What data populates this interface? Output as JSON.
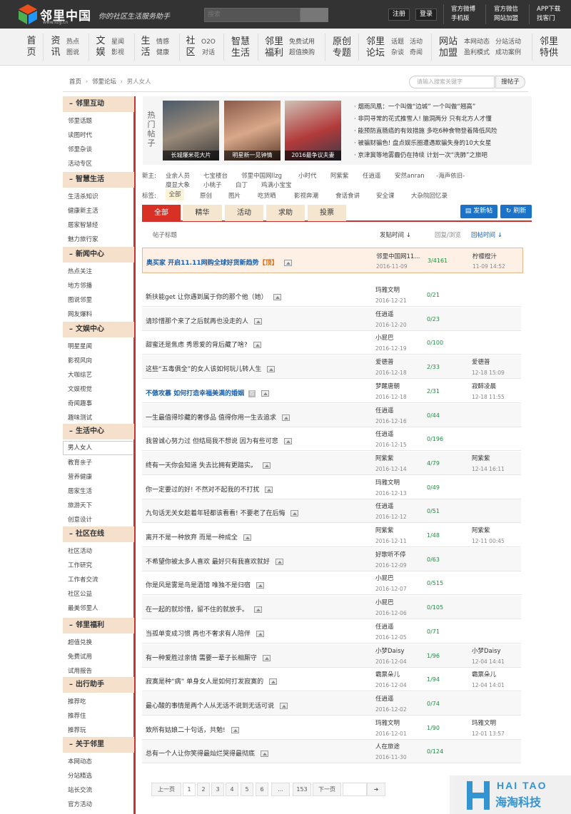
{
  "header": {
    "logo_text": "邻里中国",
    "logo_url": "www.llzg.cn",
    "slogan": "你的社区生活服务助手",
    "search_placeholder": "搜索",
    "register_label": "注册",
    "login_label": "登录",
    "links": [
      [
        "官方微博",
        "手机版"
      ],
      [
        "官方微信",
        "网站加盟"
      ],
      [
        "APP下载",
        "找客门"
      ]
    ]
  },
  "nav": {
    "items": [
      {
        "main": "首页",
        "subs": []
      },
      {
        "main": "资讯",
        "subs": [
          "热点",
          "图说"
        ]
      },
      {
        "main": "文娱",
        "subs": [
          "星闻",
          "影视"
        ]
      },
      {
        "main": "生活",
        "subs": [
          "情感",
          "健康"
        ]
      },
      {
        "main": "社区",
        "subs": [
          "O2O",
          "对话"
        ]
      },
      {
        "main": "智慧生活",
        "subs": []
      },
      {
        "main": "邻里福利",
        "subs": [
          "免费试用",
          "超值换购"
        ]
      },
      {
        "main": "原创专题",
        "subs": []
      },
      {
        "main": "邻里论坛",
        "subs": [
          "话题",
          "杂谈"
        ]
      },
      {
        "main_sub2": [
          "活动",
          "奇闻"
        ]
      },
      {
        "main": "网站加盟",
        "subs": [
          "本网动态",
          "盈利模式"
        ]
      },
      {
        "main_sub3": [
          "分站活动",
          "成功案例"
        ]
      },
      {
        "main": "邻里特供",
        "subs": []
      }
    ]
  },
  "breadcrumb": [
    "首页",
    "邻里论坛",
    "男人女人"
  ],
  "keyword_search": {
    "placeholder": "请输入搜索关键字",
    "button": "搜帖子"
  },
  "sidebar": [
    {
      "title": "邻里互动",
      "items": [
        "邻里话题",
        "读图时代",
        "邻里杂谈",
        "活动专区"
      ]
    },
    {
      "title": "智慧生活",
      "items": [
        "生活杀知识",
        "健康新主活",
        "居家智慧经",
        "魅力旅行家"
      ]
    },
    {
      "title": "新闻中心",
      "items": [
        "热点关注",
        "地方邻播",
        "图说邻里",
        "网友爆料"
      ]
    },
    {
      "title": "文娱中心",
      "items": [
        "明星星闻",
        "影视风向",
        "大咖综艺",
        "文娱视觉",
        "奇闻趣事",
        "趣味测试"
      ]
    },
    {
      "title": "生活中心",
      "items": [
        "男人女人",
        "教育亲子",
        "营养健康",
        "居家生活",
        "旅游天下",
        "创意设计"
      ]
    },
    {
      "title": "社区在线",
      "items": [
        "社区活动",
        "工作研究",
        "工作者交流",
        "社区公益",
        "最美邻里人"
      ]
    },
    {
      "title": "邻里福利",
      "items": [
        "超值兑换",
        "免费试用",
        "试用报告"
      ]
    },
    {
      "title": "出行助手",
      "items": [
        "推荐吃",
        "推荐住",
        "推荐玩"
      ]
    },
    {
      "title": "关于邻里",
      "items": [
        "本网动态",
        "分站精选",
        "站长交流",
        "官方活动"
      ]
    }
  ],
  "hot": {
    "label": "热门帖子",
    "thumbs": [
      "长城爆米花大片",
      "明星新一见钟情",
      "2016最争议夫妻"
    ],
    "news": [
      "烟雨凤凰：一个叫做“边城” 一个叫做“翘高”",
      "非同寻常的花式推雪人! 脑洞两分 只有北方人才懂",
      "能预防直肠癌的有效措施 多吃6种食物登着降低风险",
      "被骗财骗色! 盘点娱乐圈遭遇欺骗失身的10大女星",
      "京津冀等地雾霾仍在持续 计划一次“洗肺”之旅吧"
    ]
  },
  "new_users": {
    "label": "新主:",
    "names": [
      "业余人员",
      "七宝楼台",
      "邻里中国网llzg",
      "小时代",
      "阿紫紫",
      "任逍遥",
      "安然anran",
      "-海声依旧-",
      "糜显大象",
      "小桃子",
      "白丁",
      "鸡满小宝宝"
    ]
  },
  "tags": {
    "label": "标签:",
    "items": [
      "全部",
      "原创",
      "图片",
      "吃货晒",
      "影视奔潮",
      "食话食讲",
      "安全课",
      "大杂院回忆录"
    ]
  },
  "tabs": [
    "全部",
    "精华",
    "活动",
    "求助",
    "投票"
  ],
  "buttons": {
    "post": "发新帖",
    "refresh": "刷新"
  },
  "table_head": {
    "title": "帖子标题",
    "post_time": "发贴时间",
    "replies": "回复/浏览",
    "reply_time": "回帖时间"
  },
  "sticky": {
    "title": "奥买家 开启11.11网购全球好货新趋势",
    "badge": "顶",
    "author": "邻里中国网11...",
    "date": "2016-11-09",
    "stat": "3/4161",
    "last": "柠檬橙汁",
    "last_time": "11-09 14:52"
  },
  "posts": [
    {
      "title": "新扶能get 让你遇到属于你的那个他（她）",
      "author": "玛雅文明",
      "date": "2016-12-21",
      "stat": "0/21",
      "last": "",
      "ltime": "",
      "hl": false
    },
    {
      "title": "请珍惜那个来了之后就再也没走的人",
      "author": "任逍遥",
      "date": "2016-12-20",
      "stat": "0/23",
      "last": "",
      "ltime": "",
      "hl": false
    },
    {
      "title": "甜蜜还是焦虑 秀恩爱的背后藏了啥?",
      "author": "小屁巴",
      "date": "2016-12-19",
      "stat": "0/100",
      "last": "",
      "ltime": "",
      "hl": false
    },
    {
      "title": "这些“五毒俱全”的女人该如何玩儿转人生",
      "author": "爱德普",
      "date": "2016-12-18",
      "stat": "2/33",
      "last": "爱德普",
      "ltime": "12-18 15:09",
      "hl": false
    },
    {
      "title": "不傲攻慕 如何打造幸福美满的婚姻",
      "author": "梦醒唐朝",
      "date": "2016-12-18",
      "stat": "2/31",
      "last": "寂醉凌晨",
      "ltime": "12-18 11:55",
      "hl": true
    },
    {
      "title": "一生最值得珍藏的奢侈品 值得你用一生去追求",
      "author": "任逍遥",
      "date": "2016-12-16",
      "stat": "0/44",
      "last": "",
      "ltime": "",
      "hl": false
    },
    {
      "title": "我曾诚心努力过 但结局我不想说 因为有些可悲",
      "author": "任逍遥",
      "date": "2016-12-15",
      "stat": "0/196",
      "last": "",
      "ltime": "",
      "hl": false
    },
    {
      "title": "终有一天你会知道 失去比拥有更踏实。",
      "author": "阿紫紫",
      "date": "2016-12-14",
      "stat": "4/79",
      "last": "阿紫紫",
      "ltime": "12-14 16:11",
      "hl": false
    },
    {
      "title": "你一定要过的好! 不然对不起我的不打扰",
      "author": "玛雅文明",
      "date": "2016-12-13",
      "stat": "0/49",
      "last": "",
      "ltime": "",
      "hl": false
    },
    {
      "title": "九句话无关女趁着年轻都该看看! 不要老了在后悔",
      "author": "任逍遥",
      "date": "2016-12-12",
      "stat": "0/51",
      "last": "",
      "ltime": "",
      "hl": false
    },
    {
      "title": "离开不是一种放弃 而是一种成全",
      "author": "阿紫紫",
      "date": "2016-12-11",
      "stat": "1/48",
      "last": "阿紫紫",
      "ltime": "12-11 00:45",
      "hl": false
    },
    {
      "title": "不希望你被太多人喜欢 最好只有我喜欢就好",
      "author": "好歌听不停",
      "date": "2016-12-09",
      "stat": "0/63",
      "last": "",
      "ltime": "",
      "hl": false
    },
    {
      "title": "你是风是雾是鸟是酒馆 唯独不是归宿",
      "author": "小屁巴",
      "date": "2016-12-07",
      "stat": "0/515",
      "last": "",
      "ltime": "",
      "hl": false
    },
    {
      "title": "在一起的就珍惜，留不住的就放手。",
      "author": "小屁巴",
      "date": "2016-12-06",
      "stat": "0/105",
      "last": "",
      "ltime": "",
      "hl": false
    },
    {
      "title": "当孤单变成习惯 再也不奢求有人陪伴",
      "author": "任逍遥",
      "date": "2016-12-05",
      "stat": "0/71",
      "last": "",
      "ltime": "",
      "hl": false
    },
    {
      "title": "有一种爱胜过亲情 需要一辈子长相厮守",
      "author": "小梦Daisy",
      "date": "2016-12-04",
      "stat": "1/96",
      "last": "小梦Daisy",
      "ltime": "12-04 14:41",
      "hl": false
    },
    {
      "title": "寂寞是种“病” 单身女人是如何打发寂寞的",
      "author": "霸票朵儿",
      "date": "2016-12-04",
      "stat": "1/94",
      "last": "霸票朵儿",
      "ltime": "12-04 14:01",
      "hl": false
    },
    {
      "title": "最心酸的事情是两个人从无话不说到无话可说",
      "author": "任逍遥",
      "date": "2016-12-02",
      "stat": "0/74",
      "last": "",
      "ltime": "",
      "hl": false
    },
    {
      "title": "致所有姑娘二十句话，共勉!",
      "author": "玛雅文明",
      "date": "2016-12-01",
      "stat": "1/90",
      "last": "玛雅文明",
      "ltime": "12-01 13:57",
      "hl": false
    },
    {
      "title": "总有一个人让你笑得最灿烂哭得最彻底",
      "author": "人在旅途",
      "date": "2016-11-30",
      "stat": "0/124",
      "last": "",
      "ltime": "",
      "hl": false
    }
  ],
  "pagination": {
    "prev": "上一页",
    "pages": [
      "1",
      "2",
      "3",
      "4",
      "5",
      "6",
      "...",
      "153"
    ],
    "next": "下一页"
  },
  "watermark": {
    "en": "HAI TAO",
    "cn": "海淘科技"
  },
  "colors": {
    "accent": "#cc3333",
    "blue": "#1a73c8",
    "sidebar_head": "#f5e0cc"
  }
}
